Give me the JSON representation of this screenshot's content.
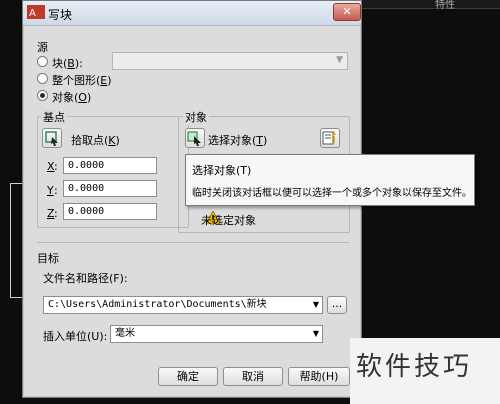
{
  "background": {
    "top_text": "特性"
  },
  "watermark": {
    "text": "软件技巧"
  },
  "dialog": {
    "title": "写块",
    "close_label": "✕",
    "source": {
      "heading": "源",
      "block_prefix": "块(",
      "block_key": "B",
      "block_suffix": "):",
      "entire_prefix": "整个图形(",
      "entire_key": "E",
      "entire_suffix": ")",
      "objects_prefix": "对象(",
      "objects_key": "O",
      "objects_suffix": ")",
      "selected": "objects"
    },
    "base_point": {
      "heading": "基点",
      "pick_prefix": "拾取点(",
      "pick_key": "K",
      "pick_suffix": ")",
      "x_label": "X",
      "x_value": "0.0000",
      "y_label": "Y",
      "y_value": "0.0000",
      "z_label": "Z",
      "z_value": "0.0000"
    },
    "objects": {
      "heading": "对象",
      "select_prefix": "选择对象(",
      "select_key": "T",
      "select_suffix": ")",
      "status": "未选定对象"
    },
    "tooltip": {
      "title": "选择对象(T)",
      "body": "临时关闭该对话框以便可以选择一个或多个对象以保存至文件。"
    },
    "target": {
      "heading": "目标",
      "path_label": "文件名和路径(F):",
      "path_value": "C:\\Users\\Administrator\\Documents\\新块",
      "browse_label": "...",
      "units_label": "插入单位(U):",
      "units_value": "毫米"
    },
    "buttons": {
      "ok": "确定",
      "cancel": "取消",
      "help": "帮助(H)"
    }
  }
}
